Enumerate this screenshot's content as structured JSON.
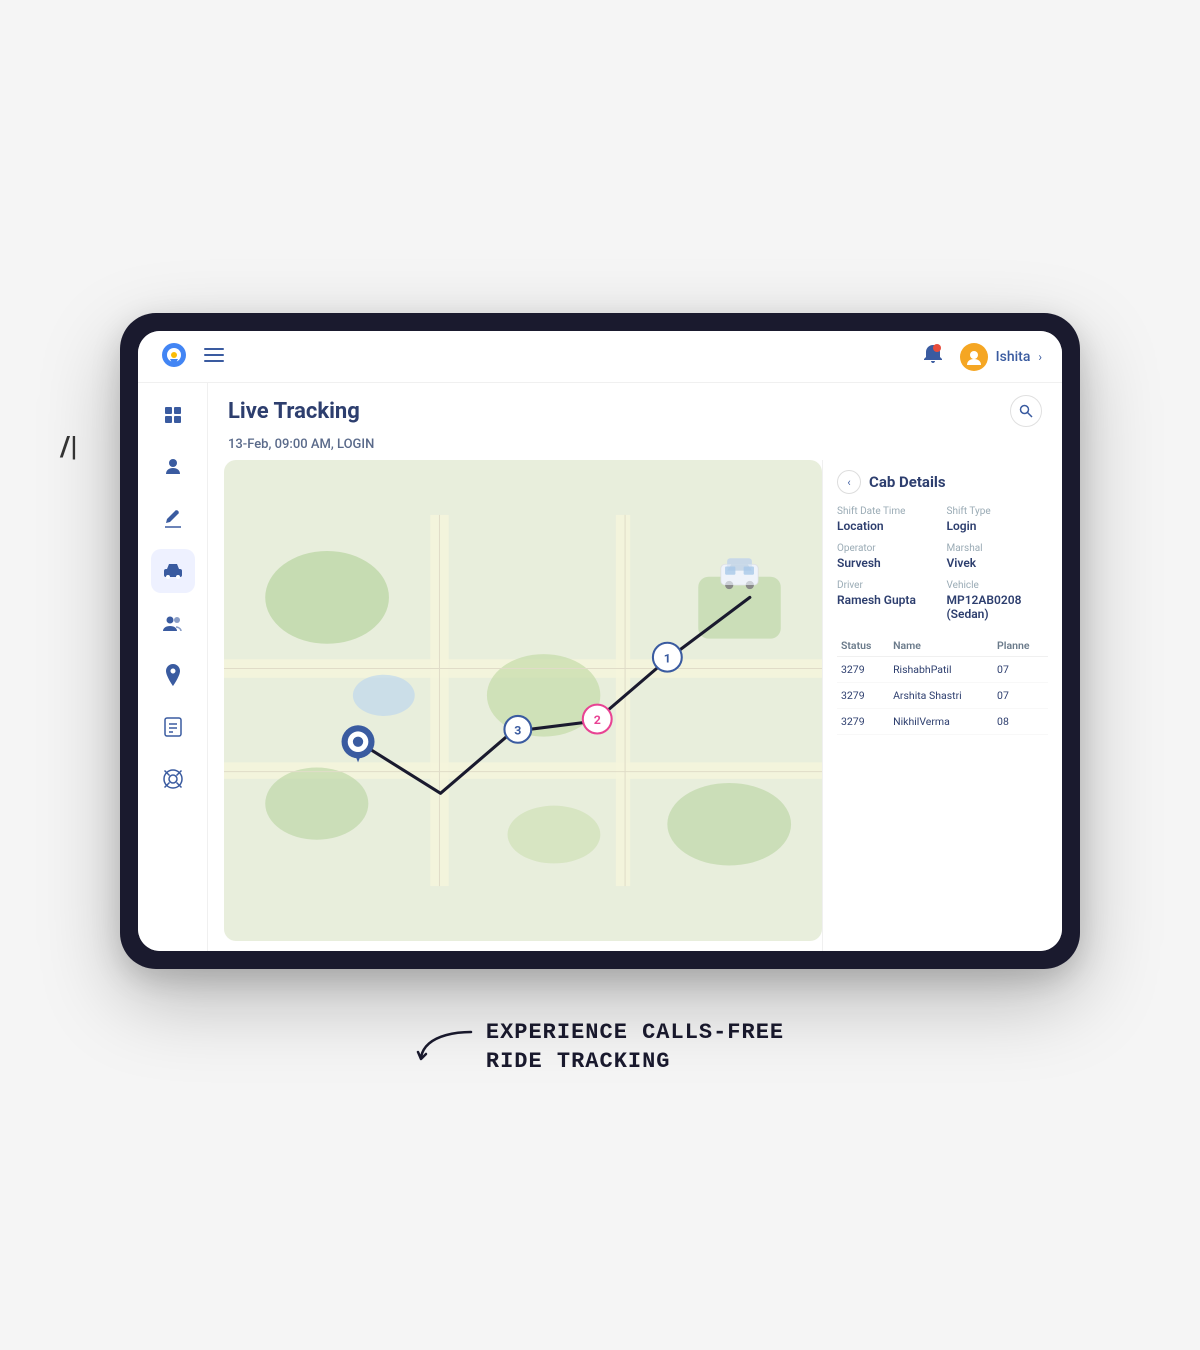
{
  "header": {
    "title": "Live Tracking",
    "search_label": "search",
    "bell_icon": "bell-icon",
    "user_name": "Ishita",
    "user_avatar": "person-icon",
    "hamburger": "menu-icon"
  },
  "date_bar": {
    "text": "13-Feb, 09:00 AM,  LOGIN"
  },
  "sidebar": {
    "items": [
      {
        "id": "dashboard",
        "icon": "grid-icon"
      },
      {
        "id": "person",
        "icon": "person-icon"
      },
      {
        "id": "edit",
        "icon": "edit-icon"
      },
      {
        "id": "car",
        "icon": "car-icon"
      },
      {
        "id": "group",
        "icon": "group-icon"
      },
      {
        "id": "location",
        "icon": "location-icon"
      },
      {
        "id": "reports",
        "icon": "reports-icon"
      },
      {
        "id": "support",
        "icon": "support-icon"
      }
    ]
  },
  "cab_details": {
    "title": "Cab Details",
    "back_label": "back",
    "fields": {
      "shift_date_time_label": "Shift Date Time",
      "shift_date_time_value": "Location",
      "shift_type_label": "Shift Type",
      "shift_type_value": "Login",
      "operator_label": "Operator",
      "operator_value": "Survesh",
      "marshal_label": "Marshal",
      "marshal_value": "Vivek",
      "driver_label": "Driver",
      "driver_value": "Ramesh Gupta",
      "vehicle_label": "Vehicle",
      "vehicle_value": "MP12AB0208 (Sedan)"
    },
    "table": {
      "columns": [
        "Status",
        "Name",
        "Planne"
      ],
      "rows": [
        {
          "status": "3279",
          "name": "RishabhPatil",
          "planned": "07"
        },
        {
          "status": "3279",
          "name": "Arshita Shastri",
          "planned": "07"
        },
        {
          "status": "3279",
          "name": "NikhilVerma",
          "planned": "08"
        }
      ]
    }
  },
  "promo": {
    "line1": "EXPERIENCE CALLS-FREE",
    "line2": "RIDE TRACKING"
  },
  "map": {
    "stops": [
      {
        "label": "1",
        "type": "circle-outline"
      },
      {
        "label": "2",
        "type": "circle-pink"
      },
      {
        "label": "3",
        "type": "circle-outline"
      },
      {
        "label": "start",
        "type": "blue-marker"
      }
    ]
  }
}
